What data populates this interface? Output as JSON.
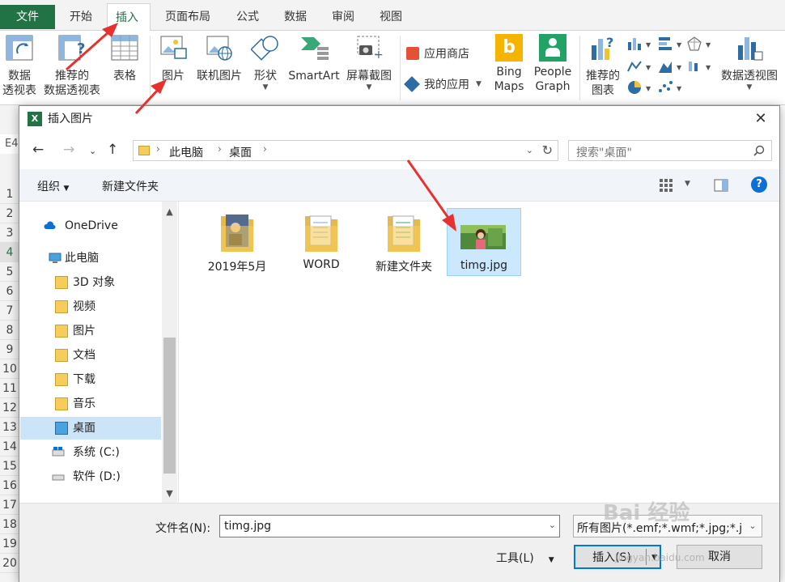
{
  "ribbon": {
    "tabs": [
      {
        "label": "文件"
      },
      {
        "label": "开始"
      },
      {
        "label": "插入"
      },
      {
        "label": "页面布局"
      },
      {
        "label": "公式"
      },
      {
        "label": "数据"
      },
      {
        "label": "审阅"
      },
      {
        "label": "视图"
      }
    ],
    "active_tab": "插入",
    "buttons": {
      "pivot_l1": "数据",
      "pivot_l2": "透视表",
      "rec_pivot_l1": "推荐的",
      "rec_pivot_l2": "数据透视表",
      "table": "表格",
      "picture": "图片",
      "online_picture": "联机图片",
      "shapes": "形状",
      "smartart": "SmartArt",
      "screenshot": "屏幕截图",
      "store": "应用商店",
      "my_apps": "我的应用",
      "bing_l1": "Bing",
      "bing_l2": "Maps",
      "people_l1": "People",
      "people_l2": "Graph",
      "rec_chart_l1": "推荐的",
      "rec_chart_l2": "图表",
      "pivot_chart": "数据透视图"
    }
  },
  "sheet": {
    "namebox": "E4",
    "rows": [
      "1",
      "2",
      "3",
      "4",
      "5",
      "6",
      "7",
      "8",
      "9",
      "10",
      "11",
      "12",
      "13",
      "14",
      "15",
      "16",
      "17",
      "18",
      "19",
      "20"
    ]
  },
  "dialog": {
    "title": "插入图片",
    "path": [
      "此电脑",
      "桌面"
    ],
    "search_placeholder": "搜索\"桌面\"",
    "toolbar": {
      "organize": "组织",
      "new_folder": "新建文件夹"
    },
    "nav_items": [
      {
        "label": "OneDrive",
        "icon": "cloud-icon"
      },
      {
        "label": "此电脑",
        "icon": "computer-icon"
      },
      {
        "label": "3D 对象",
        "icon": "folder-3d-icon"
      },
      {
        "label": "视频",
        "icon": "video-folder-icon"
      },
      {
        "label": "图片",
        "icon": "pictures-folder-icon"
      },
      {
        "label": "文档",
        "icon": "documents-folder-icon"
      },
      {
        "label": "下载",
        "icon": "downloads-folder-icon"
      },
      {
        "label": "音乐",
        "icon": "music-folder-icon"
      },
      {
        "label": "桌面",
        "icon": "desktop-folder-icon"
      },
      {
        "label": "系统 (C:)",
        "icon": "drive-c-icon"
      },
      {
        "label": "软件 (D:)",
        "icon": "drive-d-icon"
      }
    ],
    "selected_nav": "桌面",
    "files": [
      {
        "name": "2019年5月",
        "kind": "folder"
      },
      {
        "name": "WORD",
        "kind": "folder"
      },
      {
        "name": "新建文件夹",
        "kind": "folder"
      },
      {
        "name": "timg.jpg",
        "kind": "image"
      }
    ],
    "selected_file": "timg.jpg",
    "filename_label": "文件名(N):",
    "filename_value": "timg.jpg",
    "filetype_value": "所有图片(*.emf;*.wmf;*.jpg;*.j",
    "tools_label": "工具(L)",
    "insert_label": "插入(S)",
    "cancel_label": "取消"
  },
  "watermark": {
    "text": "Bai 经验",
    "url": "jingyan.baidu.com"
  },
  "colors": {
    "excel_green": "#217346",
    "selection": "#cce8ff",
    "arrow": "#e8312f",
    "primary_border": "#0078d7"
  }
}
